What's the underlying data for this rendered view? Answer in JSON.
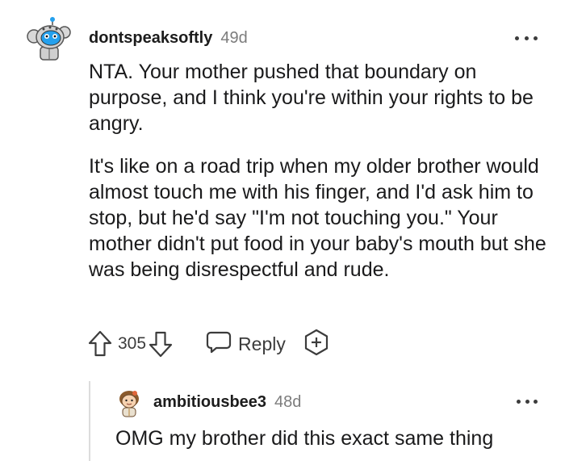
{
  "comment": {
    "username": "dontspeaksoftly",
    "age": "49d",
    "paragraphs": [
      "NTA. Your mother pushed that boundary on purpose, and I think you're within your rights to be angry.",
      "It's like on a road trip when my older brother would almost touch me with his finger, and I'd ask him to stop, but he'd say \"I'm not touching you.\" Your mother didn't put food in your baby's mouth but she was being disrespectful and rude."
    ],
    "score": "305",
    "reply_label": "Reply",
    "icons": {
      "avatar": "robot-avatar-icon",
      "more": "more-options-icon",
      "upvote": "upvote-arrow-icon",
      "downvote": "downvote-arrow-icon",
      "reply": "speech-bubble-icon",
      "award": "award-plus-icon"
    }
  },
  "reply": {
    "username": "ambitiousbee3",
    "age": "48d",
    "text": "OMG my brother did this exact same thing",
    "icons": {
      "avatar": "character-avatar-icon",
      "more": "more-options-icon"
    }
  },
  "colors": {
    "text": "#1a1a1b",
    "meta": "#7c7c7c",
    "icon": "#3c3c3c",
    "avatar_accent": "#24a0ed",
    "thread_line": "#dcdcdc"
  }
}
